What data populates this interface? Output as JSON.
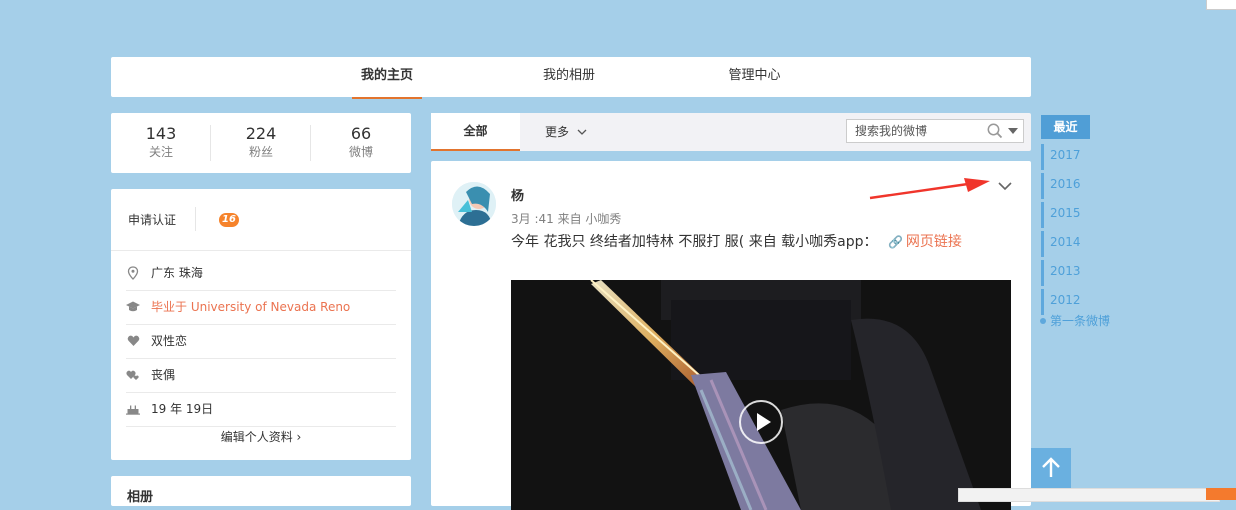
{
  "nav": {
    "tabs": [
      "我的主页",
      "我的相册",
      "管理中心"
    ]
  },
  "stats": [
    {
      "num": "143",
      "label": "关注"
    },
    {
      "num": "224",
      "label": "粉丝"
    },
    {
      "num": "66",
      "label": "微博"
    }
  ],
  "profile": {
    "cert_label": "申请认证",
    "badge": "16",
    "rows": [
      {
        "icon": "location-icon",
        "text": "广东 珠海"
      },
      {
        "icon": "graduation-cap-icon",
        "text": "毕业于 University of Nevada Reno"
      },
      {
        "icon": "heart-icon",
        "text": "双性恋"
      },
      {
        "icon": "relationship-icon",
        "text": "丧偶"
      },
      {
        "icon": "birthday-cake-icon",
        "text": "19  年  19日"
      }
    ],
    "edit_link": "编辑个人资料 ›"
  },
  "album": {
    "title": "相册"
  },
  "feed_tabs": {
    "all": "全部",
    "more": "更多",
    "search_placeholder": "搜索我的微博"
  },
  "post": {
    "author": "杨",
    "meta": "3月  :41 来自 小咖秀",
    "text": "今年  花我只  终结者加特林  不服打  服( 来自  载小咖秀app：",
    "link_text": "网页链接"
  },
  "timeline": {
    "current": "最近",
    "years": [
      "2017",
      "2016",
      "2015",
      "2014",
      "2013",
      "2012"
    ],
    "first": "第一条微博"
  },
  "colors": {
    "accent": "#e2742e",
    "link": "#eb7350",
    "timeline": "#4ea0d9",
    "annotation": "#f0352b"
  }
}
